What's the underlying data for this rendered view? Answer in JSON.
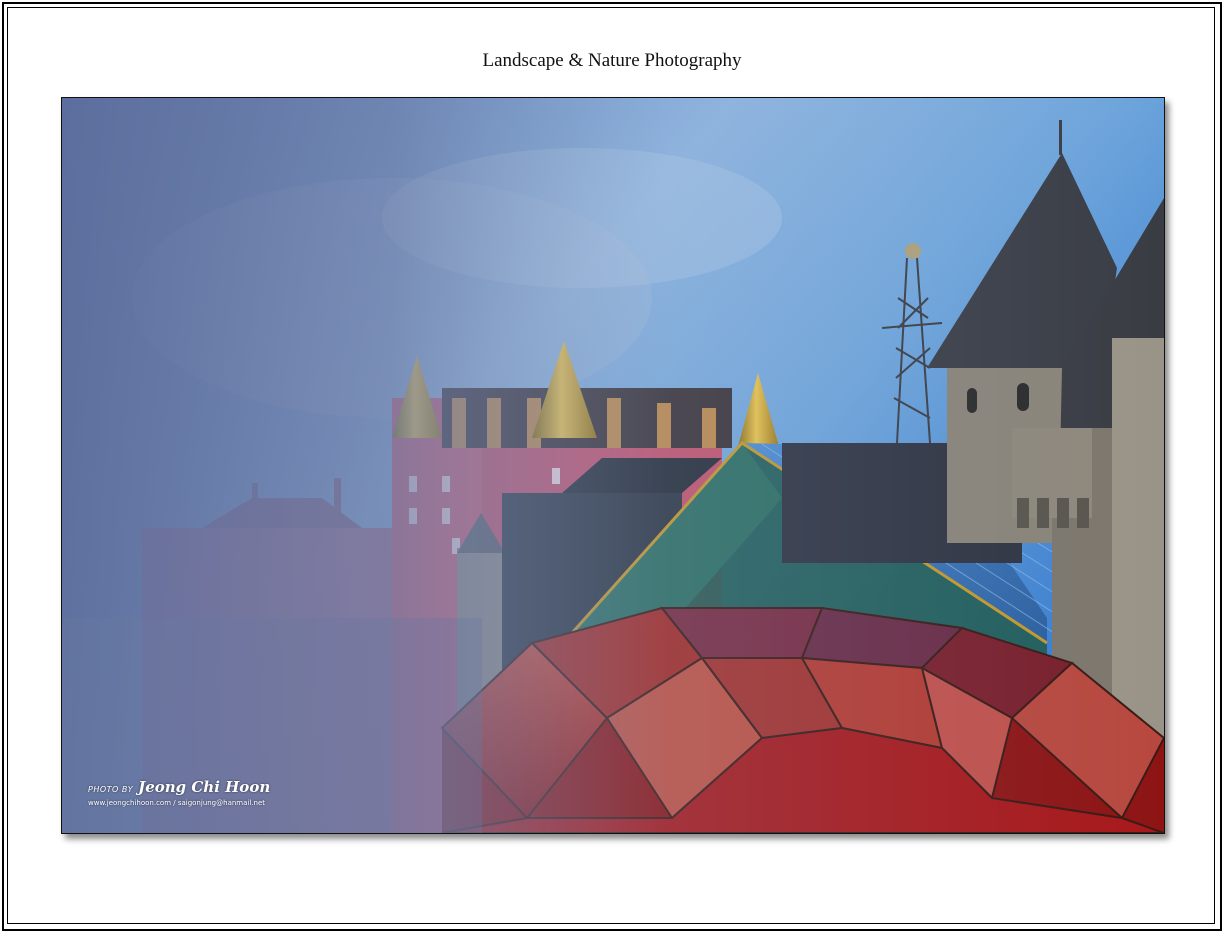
{
  "page": {
    "title": "Landscape & Nature Photography"
  },
  "photo": {
    "subject": "fantasy castle buildings with golden spires, pink facade, blue glass roof and red faceted dome in mist",
    "watermark": {
      "credit": "PHOTO BY",
      "name": "Jeong Chi Hoon",
      "contact": "www.jeongchihoon.com / saigonjung@hanmail.net"
    }
  },
  "colors": {
    "sky_top": "#3a7fd0",
    "sky_light": "#9cc9ec",
    "fog": "#6f7fa8",
    "pink_building": "#d8647a",
    "gold_spire": "#d9a81e",
    "slate_roof": "#2b2f38",
    "blue_glass": "#3b7bc4",
    "red_dome": "#b3231f",
    "stone": "#8b8478"
  }
}
